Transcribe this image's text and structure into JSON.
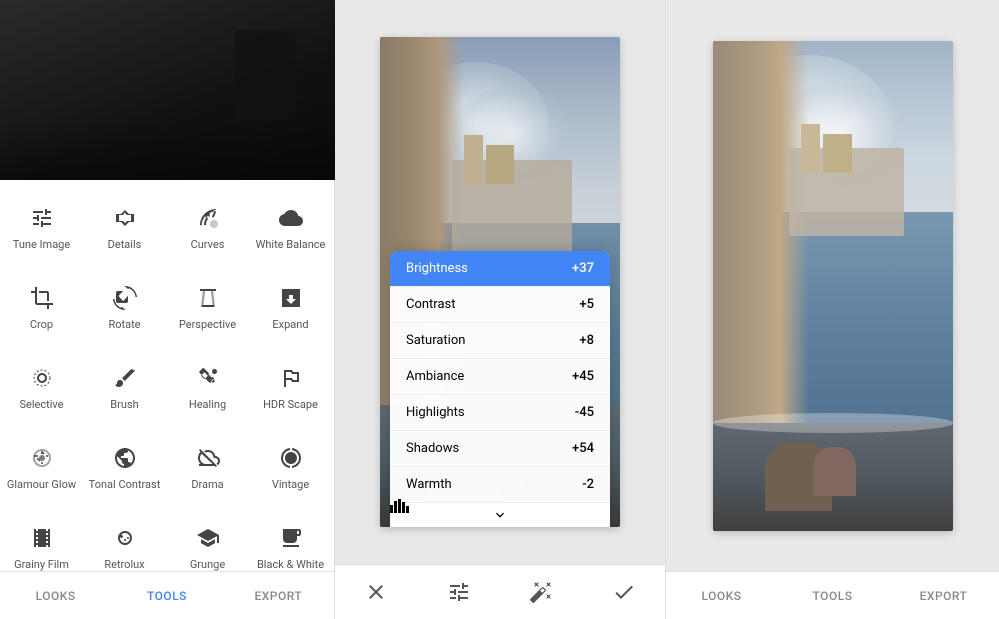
{
  "left": {
    "tools": [
      {
        "row": 0,
        "items": [
          {
            "id": "tune-image",
            "label": "Tune Image",
            "icon": "tune"
          },
          {
            "id": "details",
            "label": "Details",
            "icon": "details"
          },
          {
            "id": "curves",
            "label": "Curves",
            "icon": "curves"
          },
          {
            "id": "white-balance",
            "label": "White Balance",
            "icon": "wb"
          }
        ]
      },
      {
        "row": 1,
        "items": [
          {
            "id": "crop",
            "label": "Crop",
            "icon": "crop"
          },
          {
            "id": "rotate",
            "label": "Rotate",
            "icon": "rotate"
          },
          {
            "id": "perspective",
            "label": "Perspective",
            "icon": "perspective"
          },
          {
            "id": "expand",
            "label": "Expand",
            "icon": "expand"
          }
        ]
      },
      {
        "row": 2,
        "items": [
          {
            "id": "selective",
            "label": "Selective",
            "icon": "selective"
          },
          {
            "id": "brush",
            "label": "Brush",
            "icon": "brush"
          },
          {
            "id": "healing",
            "label": "Healing",
            "icon": "healing"
          },
          {
            "id": "hdr-scape",
            "label": "HDR Scape",
            "icon": "hdr"
          }
        ]
      },
      {
        "row": 3,
        "items": [
          {
            "id": "glamour-glow",
            "label": "Glamour Glow",
            "icon": "glamour"
          },
          {
            "id": "tonal-contrast",
            "label": "Tonal Contrast",
            "icon": "tonal"
          },
          {
            "id": "drama",
            "label": "Drama",
            "icon": "drama"
          },
          {
            "id": "vintage",
            "label": "Vintage",
            "icon": "vintage"
          }
        ]
      },
      {
        "row": 4,
        "items": [
          {
            "id": "grainy-film",
            "label": "Grainy Film",
            "icon": "grainy"
          },
          {
            "id": "retrolux",
            "label": "Retrolux",
            "icon": "retrolux"
          },
          {
            "id": "grunge",
            "label": "Grunge",
            "icon": "grunge"
          },
          {
            "id": "black-white",
            "label": "Black & White",
            "icon": "bw"
          }
        ]
      }
    ],
    "nav": [
      {
        "id": "looks",
        "label": "LOOKS",
        "active": false
      },
      {
        "id": "tools",
        "label": "TOOLS",
        "active": true
      },
      {
        "id": "export",
        "label": "EXPORT",
        "active": false
      }
    ]
  },
  "middle": {
    "adjustments": [
      {
        "name": "Brightness",
        "value": "+37",
        "active": true
      },
      {
        "name": "Contrast",
        "value": "+5",
        "active": false
      },
      {
        "name": "Saturation",
        "value": "+8",
        "active": false
      },
      {
        "name": "Ambiance",
        "value": "+45",
        "active": false
      },
      {
        "name": "Highlights",
        "value": "-45",
        "active": false
      },
      {
        "name": "Shadows",
        "value": "+54",
        "active": false
      },
      {
        "name": "Warmth",
        "value": "-2",
        "active": false
      }
    ],
    "bottom_actions": [
      {
        "id": "cancel",
        "icon": "×"
      },
      {
        "id": "tune",
        "icon": "tune"
      },
      {
        "id": "magic",
        "icon": "magic"
      },
      {
        "id": "check",
        "icon": "✓"
      }
    ]
  },
  "right": {
    "nav": [
      {
        "id": "looks",
        "label": "LOOKS",
        "active": false
      },
      {
        "id": "tools",
        "label": "TOOLS",
        "active": false
      },
      {
        "id": "export",
        "label": "EXPORT",
        "active": false
      }
    ]
  },
  "colors": {
    "active_blue": "#4285f4",
    "text_gray": "#888",
    "text_dark": "#444",
    "border": "#e0e0e0"
  }
}
